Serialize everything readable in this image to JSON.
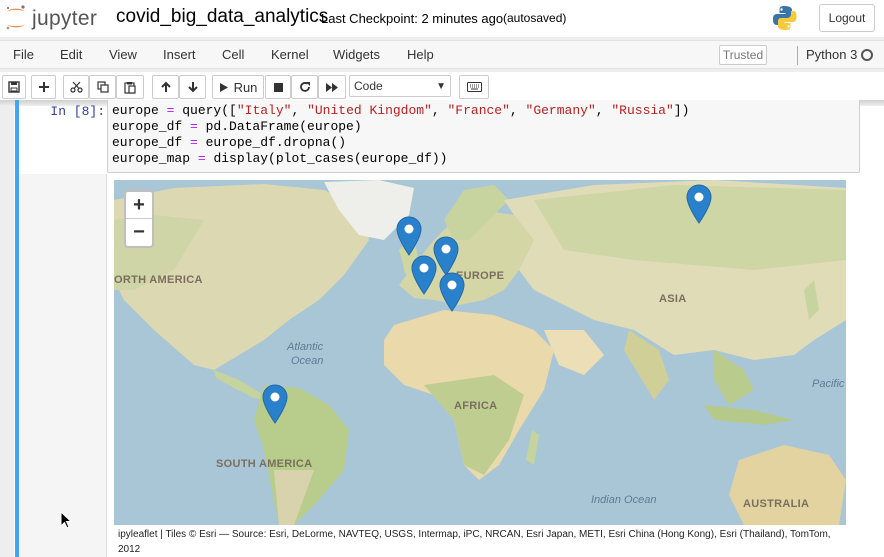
{
  "header": {
    "logo_text": "jupyter",
    "notebook_title": "covid_big_data_analytics",
    "checkpoint": "Last Checkpoint: 2 minutes ago",
    "autosave_status": "(autosaved)",
    "logout_label": "Logout"
  },
  "menubar": {
    "items": [
      "File",
      "Edit",
      "View",
      "Insert",
      "Cell",
      "Kernel",
      "Widgets",
      "Help"
    ],
    "trusted_label": "Trusted",
    "kernel_name": "Python 3"
  },
  "toolbar": {
    "run_label": "Run",
    "cell_type": "Code",
    "icons": [
      "save-icon",
      "plus-icon",
      "scissors-icon",
      "copy-icon",
      "paste-icon",
      "arrow-up-icon",
      "arrow-down-icon",
      "run-icon",
      "stop-icon",
      "restart-icon",
      "fast-forward-icon",
      "keyboard-icon"
    ]
  },
  "cell": {
    "prompt": "In [8]:",
    "code": [
      {
        "var": "europe",
        "rest": " = query([",
        "strings": [
          "\"Italy\"",
          "\"United Kingdom\"",
          "\"France\"",
          "\"Germany\"",
          "\"Russia\""
        ],
        "end": "])"
      },
      {
        "text": "europe_df = pd.DataFrame(europe)"
      },
      {
        "text": "europe_df = europe_df.dropna()"
      },
      {
        "text": "europe_map = display(plot_cases(europe_df))"
      }
    ],
    "line1_pre": "europe ",
    "line1_eq": "=",
    "line1_mid": " query([",
    "s1": "\"Italy\"",
    "s2": "\"United Kingdom\"",
    "s3": "\"France\"",
    "s4": "\"Germany\"",
    "s5": "\"Russia\"",
    "line1_end": "])",
    "line2_pre": "europe_df ",
    "line2_eq": "=",
    "line2_post": " pd.DataFrame(europe)",
    "line3_pre": "europe_df ",
    "line3_eq": "=",
    "line3_post": " europe_df.dropna()",
    "line4_pre": "europe_map ",
    "line4_eq": "=",
    "line4_post": " display(plot_cases(europe_df))"
  },
  "map": {
    "zoom_in": "+",
    "zoom_out": "−",
    "labels": {
      "north_america": "ORTH AMERICA",
      "europe": "EUROPE",
      "asia": "ASIA",
      "africa": "AFRICA",
      "south_america": "SOUTH AMERICA",
      "australia": "AUSTRALIA",
      "atlantic_1": "Atlantic",
      "atlantic_2": "Ocean",
      "indian": "Indian Ocean",
      "pacific": "Pacific"
    },
    "markers": [
      "United Kingdom",
      "Germany",
      "France",
      "Italy",
      "Russia",
      "French Guiana"
    ],
    "attribution": "ipyleaflet | Tiles © Esri — Source: Esri, DeLorme, NAVTEQ, USGS, Intermap, iPC, NRCAN, Esri Japan, METI, Esri China (Hong Kong), Esri (Thailand), TomTom, 2012",
    "colors": {
      "marker": "#2a81cb",
      "ocean": "#a9c6d6",
      "land": "#e8e0c8"
    }
  }
}
